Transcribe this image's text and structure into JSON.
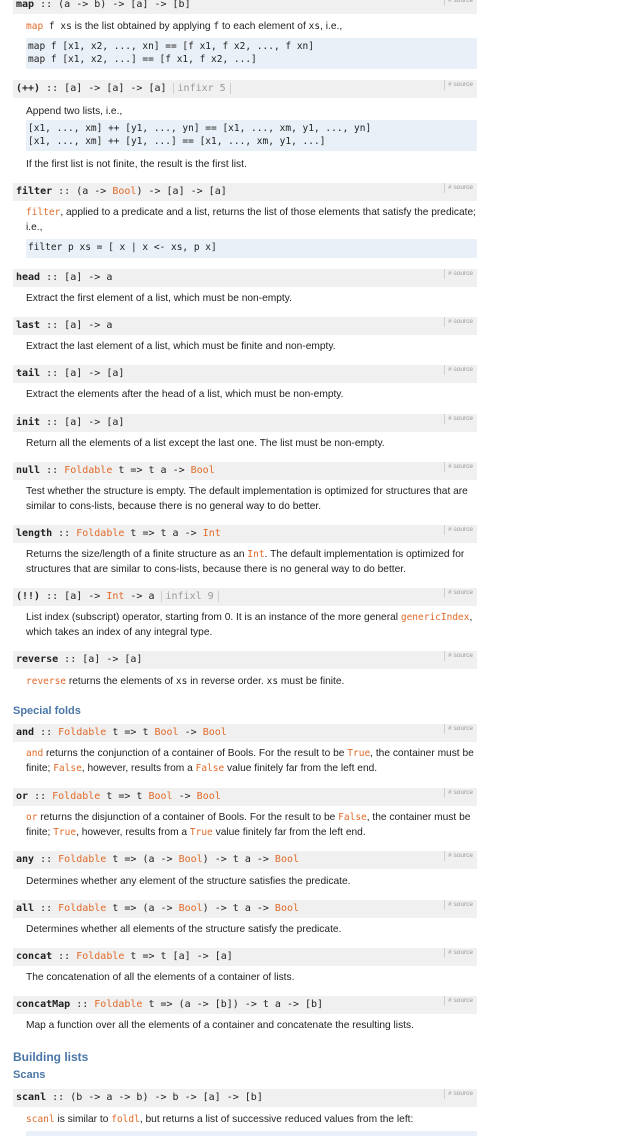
{
  "colors": {
    "type_link": "#e06a2a",
    "heading": "#4a76a8",
    "sig_bg": "#f0f0f0",
    "code_bg": "#e9f0f7"
  },
  "source_label": "# source",
  "map": {
    "name": "map",
    "sig": " :: (a -> b) -> [a] -> [b]",
    "desc_link": "map",
    "desc_a": " f ",
    "desc_xs": "xs",
    "desc_b": " is the list obtained by applying ",
    "desc_f": "f",
    "desc_c": " to each element of ",
    "desc_xs2": "xs",
    "desc_d": ", i.e.,",
    "code": "map f [x1, x2, ..., xn] == [f x1, f x2, ..., f xn]\nmap f [x1, x2, ...] == [f x1, f x2, ...]"
  },
  "append": {
    "name": "(++)",
    "sig": " :: [a] -> [a] -> [a]",
    "fixity": "infixr 5",
    "desc1": "Append two lists, i.e.,",
    "code": "[x1, ..., xm] ++ [y1, ..., yn] == [x1, ..., xm, y1, ..., yn]\n[x1, ..., xm] ++ [y1, ...] == [x1, ..., xm, y1, ...]",
    "desc2": "If the first list is not finite, the result is the first list."
  },
  "filter": {
    "name": "filter",
    "sig_a": " :: (a -> ",
    "bool": "Bool",
    "sig_b": ") -> [a] -> [a]",
    "desc_link": "filter",
    "desc": ", applied to a predicate and a list, returns the list of those elements that satisfy the predicate; i.e.,",
    "code": "filter p xs = [ x | x <- xs, p x]"
  },
  "head": {
    "name": "head",
    "sig": " :: [a] -> a",
    "desc": "Extract the first element of a list, which must be non-empty."
  },
  "last": {
    "name": "last",
    "sig": " :: [a] -> a",
    "desc": "Extract the last element of a list, which must be finite and non-empty."
  },
  "tail": {
    "name": "tail",
    "sig": " :: [a] -> [a]",
    "desc": "Extract the elements after the head of a list, which must be non-empty."
  },
  "init": {
    "name": "init",
    "sig": " :: [a] -> [a]",
    "desc": "Return all the elements of a list except the last one. The list must be non-empty."
  },
  "null": {
    "name": "null",
    "sig_a": " :: ",
    "foldable": "Foldable",
    "sig_b": " t => t a -> ",
    "bool": "Bool",
    "desc": "Test whether the structure is empty. The default implementation is optimized for structures that are similar to cons-lists, because there is no general way to do better."
  },
  "length": {
    "name": "length",
    "sig_a": " :: ",
    "foldable": "Foldable",
    "sig_b": " t => t a -> ",
    "int": "Int",
    "desc_a": "Returns the size/length of a finite structure as an ",
    "desc_int": "Int",
    "desc_b": ". The default implementation is optimized for structures that are similar to cons-lists, because there is no general way to do better."
  },
  "index": {
    "name": "(!!)",
    "sig_a": " :: [a] -> ",
    "int": "Int",
    "sig_b": " -> a",
    "fixity": "infixl 9",
    "desc_a": "List index (subscript) operator, starting from 0. It is an instance of the more general ",
    "desc_link": "genericIndex",
    "desc_b": ", which takes an index of any integral type."
  },
  "reverse": {
    "name": "reverse",
    "sig": " :: [a] -> [a]",
    "desc_link": "reverse",
    "desc_xs": "xs",
    "desc_a": " returns the elements of ",
    "desc_b": " in reverse order. ",
    "desc_c": " must be finite."
  },
  "special_folds": "Special folds",
  "and": {
    "name": "and",
    "sig_a": " :: ",
    "foldable": "Foldable",
    "sig_b": " t => t ",
    "bool": "Bool",
    "sig_c": " -> ",
    "bool2": "Bool",
    "desc_link": "and",
    "desc_a": " returns the conjunction of a container of Bools. For the result to be ",
    "v1": "True",
    "desc_b": ", the container must be finite; ",
    "v2": "False",
    "desc_c": ", however, results from a ",
    "v3": "False",
    "desc_d": " value finitely far from the left end."
  },
  "or": {
    "name": "or",
    "sig_a": " :: ",
    "foldable": "Foldable",
    "sig_b": " t => t ",
    "bool": "Bool",
    "sig_c": " -> ",
    "bool2": "Bool",
    "desc_link": "or",
    "desc_a": " returns the disjunction of a container of Bools. For the result to be ",
    "v1": "False",
    "desc_b": ", the container must be finite; ",
    "v2": "True",
    "desc_c": ", however, results from a ",
    "v3": "True",
    "desc_d": " value finitely far from the left end."
  },
  "any": {
    "name": "any",
    "sig_a": " :: ",
    "foldable": "Foldable",
    "sig_b": " t => (a -> ",
    "bool": "Bool",
    "sig_c": ") -> t a -> ",
    "bool2": "Bool",
    "desc": "Determines whether any element of the structure satisfies the predicate."
  },
  "all": {
    "name": "all",
    "sig_a": " :: ",
    "foldable": "Foldable",
    "sig_b": " t => (a -> ",
    "bool": "Bool",
    "sig_c": ") -> t a -> ",
    "bool2": "Bool",
    "desc": "Determines whether all elements of the structure satisfy the predicate."
  },
  "concat": {
    "name": "concat",
    "sig_a": " :: ",
    "foldable": "Foldable",
    "sig_b": " t => t [a] -> [a]",
    "desc": "The concatenation of all the elements of a container of lists."
  },
  "concatMap": {
    "name": "concatMap",
    "sig_a": " :: ",
    "foldable": "Foldable",
    "sig_b": " t => (a -> [b]) -> t a -> [b]",
    "desc": "Map a function over all the elements of a container and concatenate the resulting lists."
  },
  "building_lists": "Building lists",
  "scans": "Scans",
  "scanl": {
    "name": "scanl",
    "sig": " :: (b -> a -> b) -> b -> [a] -> [b]",
    "desc_link": "scanl",
    "desc_a": " is similar to ",
    "desc_link2": "foldl",
    "desc_b": ", but returns a list of successive reduced values from the left:"
  }
}
